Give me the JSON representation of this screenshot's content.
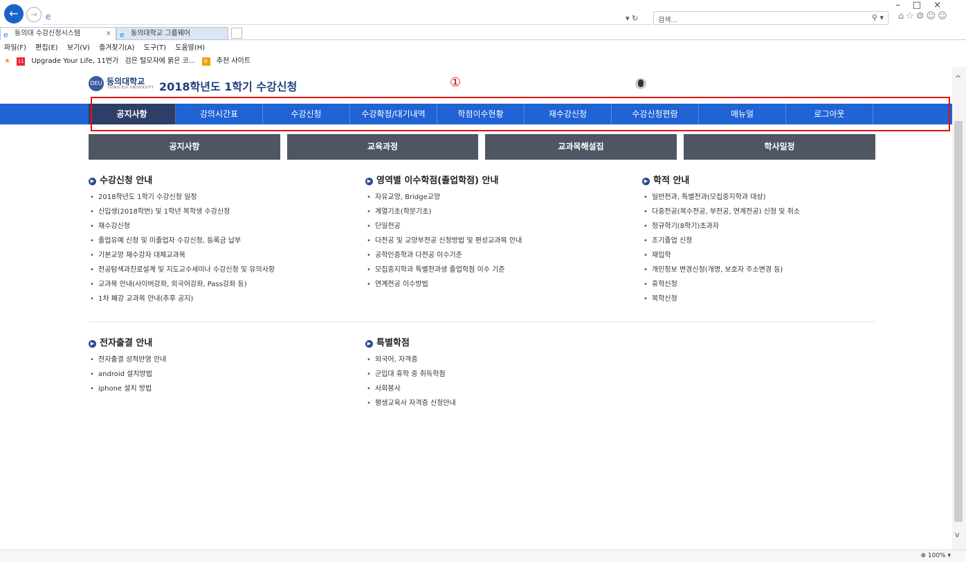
{
  "browser": {
    "address_icon": "ie-page-icon",
    "search_placeholder": "검색...",
    "tabs": [
      {
        "label": "동의대 수강신청시스템",
        "close": "×"
      },
      {
        "label": "동의대학교 그룹웨어"
      }
    ],
    "menu": [
      "파일(F)",
      "편집(E)",
      "보기(V)",
      "즐겨찾기(A)",
      "도구(T)",
      "도움말(H)"
    ],
    "favorites": [
      "Upgrade Your Life, 11번가",
      "검은 털모자에 붉은 코...",
      "추천 사이트"
    ],
    "zoom": "100%"
  },
  "header": {
    "logo_text": "동의대학교",
    "logo_sub": "DONG-EUI UNIVERSITY",
    "title": "2018학년도 1학기 수강신청",
    "marker": "①"
  },
  "nav": {
    "items": [
      "공지사항",
      "강의시간표",
      "수강신청",
      "수강확정/대기내역",
      "학점이수현황",
      "재수강신청",
      "수강신청편람",
      "매뉴얼",
      "로그아웃"
    ]
  },
  "quick_links": [
    "공지사항",
    "교육과정",
    "교과목해설집",
    "학사일정"
  ],
  "sections": {
    "course_reg": {
      "title": "수강신청 안내",
      "items": [
        "2018학년도 1학기 수강신청 일정",
        "신입생(2018학번) 및 1학년 복학생 수강신청",
        "재수강신청",
        "졸업유예 신청 및 미졸업자 수강신청, 등록금 납부",
        "기본교양 재수강자 대체교과목",
        "전공탐색과진로설계 및 지도교수세미나 수강신청 및 유의사항",
        "교과목 안내(사이버강좌, 외국어강좌, Pass강좌 등)",
        "1차 폐강 교과목 안내(추후 공지)"
      ]
    },
    "area_credit": {
      "title": "영역별 이수학점(졸업학점) 안내",
      "items": [
        "자유교양, Bridge교양",
        "계열기초(학문기초)",
        "단일전공",
        "다전공 및 교양부전공 신청방법 및 편성교과목 안내",
        "공학인증학과 다전공 이수기준",
        "모집중지학과 특별전과생 졸업학점 이수 기준",
        "연계전공 이수방법"
      ]
    },
    "academic": {
      "title": "학적 안내",
      "items": [
        "일반전과, 특별전과(모집중지학과 대상)",
        "다중전공(복수전공, 부전공, 연계전공) 신청 및 취소",
        "정규학기(8학기)초과자",
        "조기졸업 신청",
        "재입학",
        "개인정보 변경신청(개명, 보호자 주소변경 등)",
        "휴학신청",
        "복학신청"
      ]
    },
    "attendance": {
      "title": "전자출결 안내",
      "items": [
        "전자출결 성적반영 안내",
        "android 설치방법",
        "iphone 설치 방법"
      ]
    },
    "special": {
      "title": "특별학점",
      "items": [
        "외국어, 자격증",
        "군입대 휴학 중 취득학점",
        "사회봉사",
        "평생교육사 자격증 신청안내"
      ]
    }
  },
  "colors": {
    "nav_bg": "#1f63d4",
    "nav_active": "#2d3f66",
    "quick_bg": "#4f5663",
    "highlight": "#e01010"
  }
}
